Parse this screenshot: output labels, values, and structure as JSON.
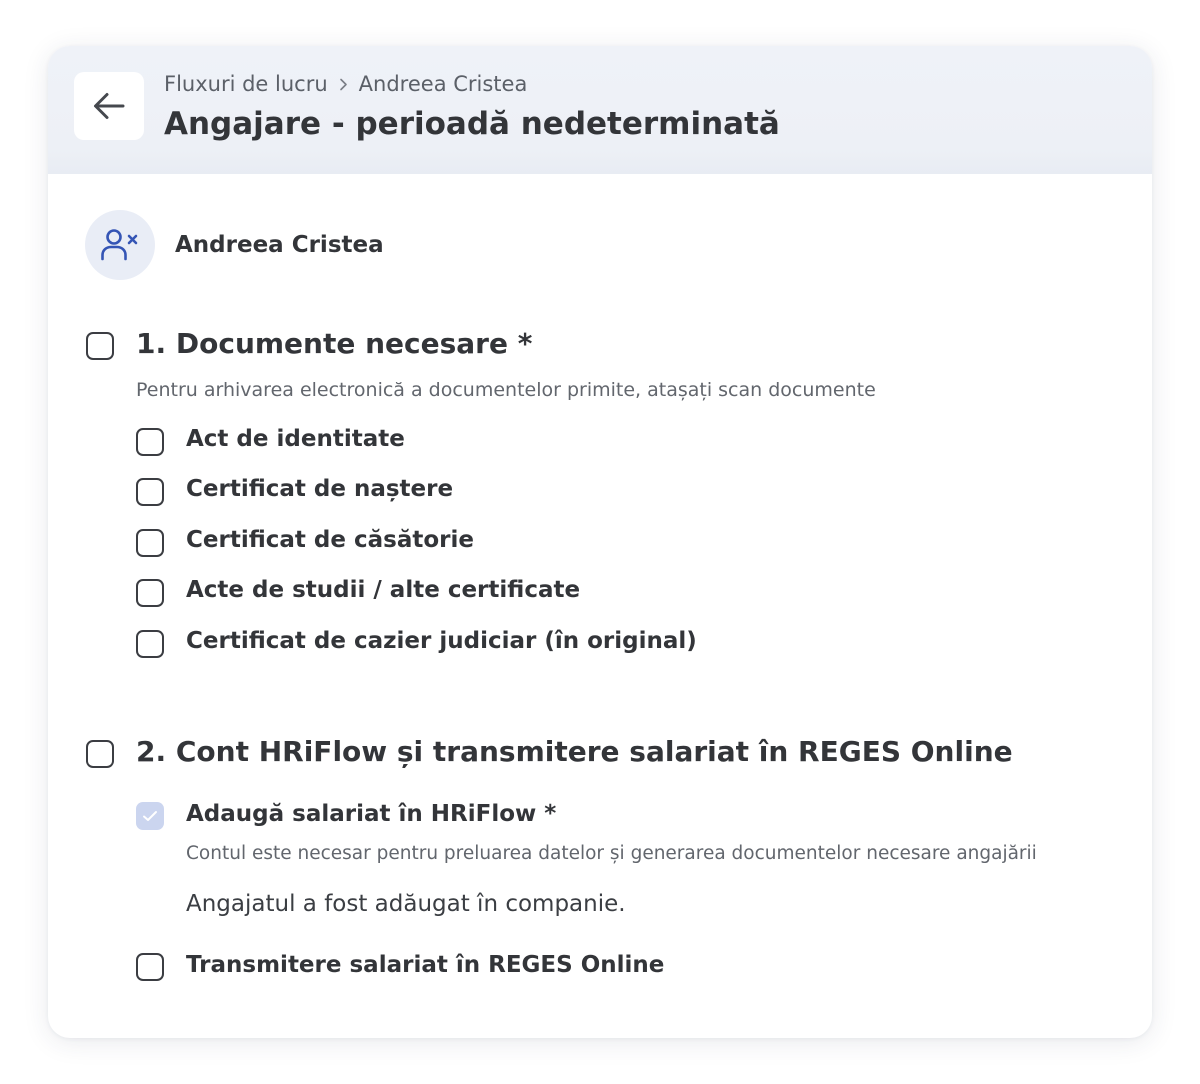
{
  "header": {
    "breadcrumb": [
      "Fluxuri de lucru",
      "Andreea Cristea"
    ],
    "title": "Angajare - perioadă nedeterminată",
    "back_icon": "arrow-left-icon"
  },
  "person": {
    "name": "Andreea Cristea",
    "icon": "user-x-icon",
    "accent": "#3555b5"
  },
  "sections": [
    {
      "title": "1. Documente necesare *",
      "checked": false,
      "description": "Pentru arhivarea electronică a documentelor primite, atașați scan documente",
      "items": [
        {
          "label": "Act de identitate",
          "checked": false
        },
        {
          "label": "Certificat de naștere",
          "checked": false
        },
        {
          "label": "Certificat de căsătorie",
          "checked": false
        },
        {
          "label": "Acte de studii / alte certificate",
          "checked": false
        },
        {
          "label": "Certificat de cazier judiciar (în original)",
          "checked": false
        }
      ]
    },
    {
      "title": "2. Cont HRiFlow și transmitere salariat în REGES Online",
      "checked": false,
      "items": [
        {
          "label": "Adaugă salariat în HRiFlow *",
          "checked": true,
          "disabled": true,
          "subtitle": "Contul este necesar pentru preluarea datelor și generarea documentelor necesare angajării",
          "note": "Angajatul a fost adăugat în companie."
        },
        {
          "label": "Transmitere salariat în REGES Online",
          "checked": false
        }
      ]
    }
  ]
}
